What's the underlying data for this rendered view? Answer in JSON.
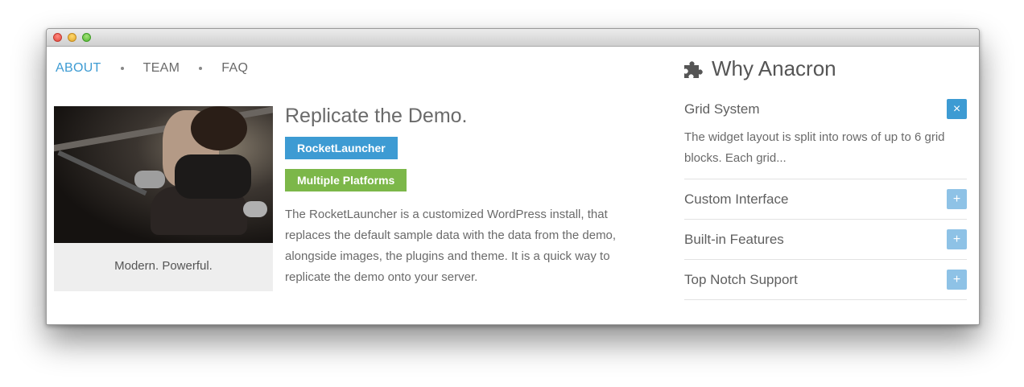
{
  "nav": {
    "items": [
      "ABOUT",
      "TEAM",
      "FAQ"
    ],
    "active": "ABOUT"
  },
  "image_card": {
    "caption": "Modern. Powerful."
  },
  "main": {
    "title": "Replicate the Demo.",
    "tags": [
      "RocketLauncher",
      "Multiple Platforms"
    ],
    "description": "The RocketLauncher is a customized WordPress install, that replaces the default sample data with the data from the demo, alongside images, the plugins and theme. It is a quick way to replicate the demo onto your server."
  },
  "sidebar": {
    "heading": "Why Anacron",
    "accordion": [
      {
        "title": "Grid System",
        "button": "×",
        "body": "The widget layout is split into rows of up to 6 grid blocks. Each grid..."
      },
      {
        "title": "Custom Interface",
        "button": "+"
      },
      {
        "title": "Built-in Features",
        "button": "+"
      },
      {
        "title": "Top Notch Support",
        "button": "+"
      }
    ]
  },
  "colors": {
    "accent": "#3d9bd3",
    "green": "#7cb749",
    "collapsed_button": "#8ec2e6"
  }
}
